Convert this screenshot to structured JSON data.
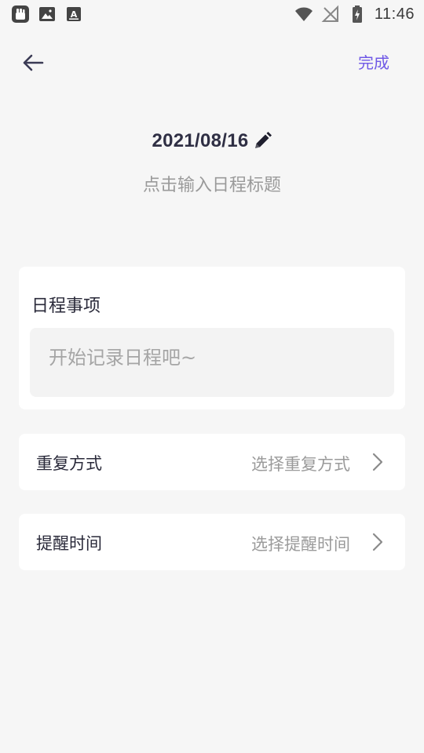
{
  "status_bar": {
    "time": "11:46",
    "left_icons": [
      "notification-icon",
      "image-icon",
      "text-icon"
    ],
    "right_icons": [
      "wifi-icon",
      "no-signal-icon",
      "battery-charging-icon"
    ]
  },
  "header": {
    "back_icon": "arrow-left-icon",
    "done_label": "完成"
  },
  "title_block": {
    "date": "2021/08/16",
    "edit_icon": "pencil-icon",
    "title_placeholder": "点击输入日程标题"
  },
  "events_card": {
    "label": "日程事项",
    "placeholder": "开始记录日程吧~"
  },
  "repeat_row": {
    "label": "重复方式",
    "value": "选择重复方式"
  },
  "remind_row": {
    "label": "提醒时间",
    "value": "选择提醒时间"
  },
  "colors": {
    "accent": "#6f58e6",
    "background": "#f6f6f6",
    "card": "#ffffff",
    "placeholder": "#9a9a9a",
    "text": "#2a2a3a"
  }
}
